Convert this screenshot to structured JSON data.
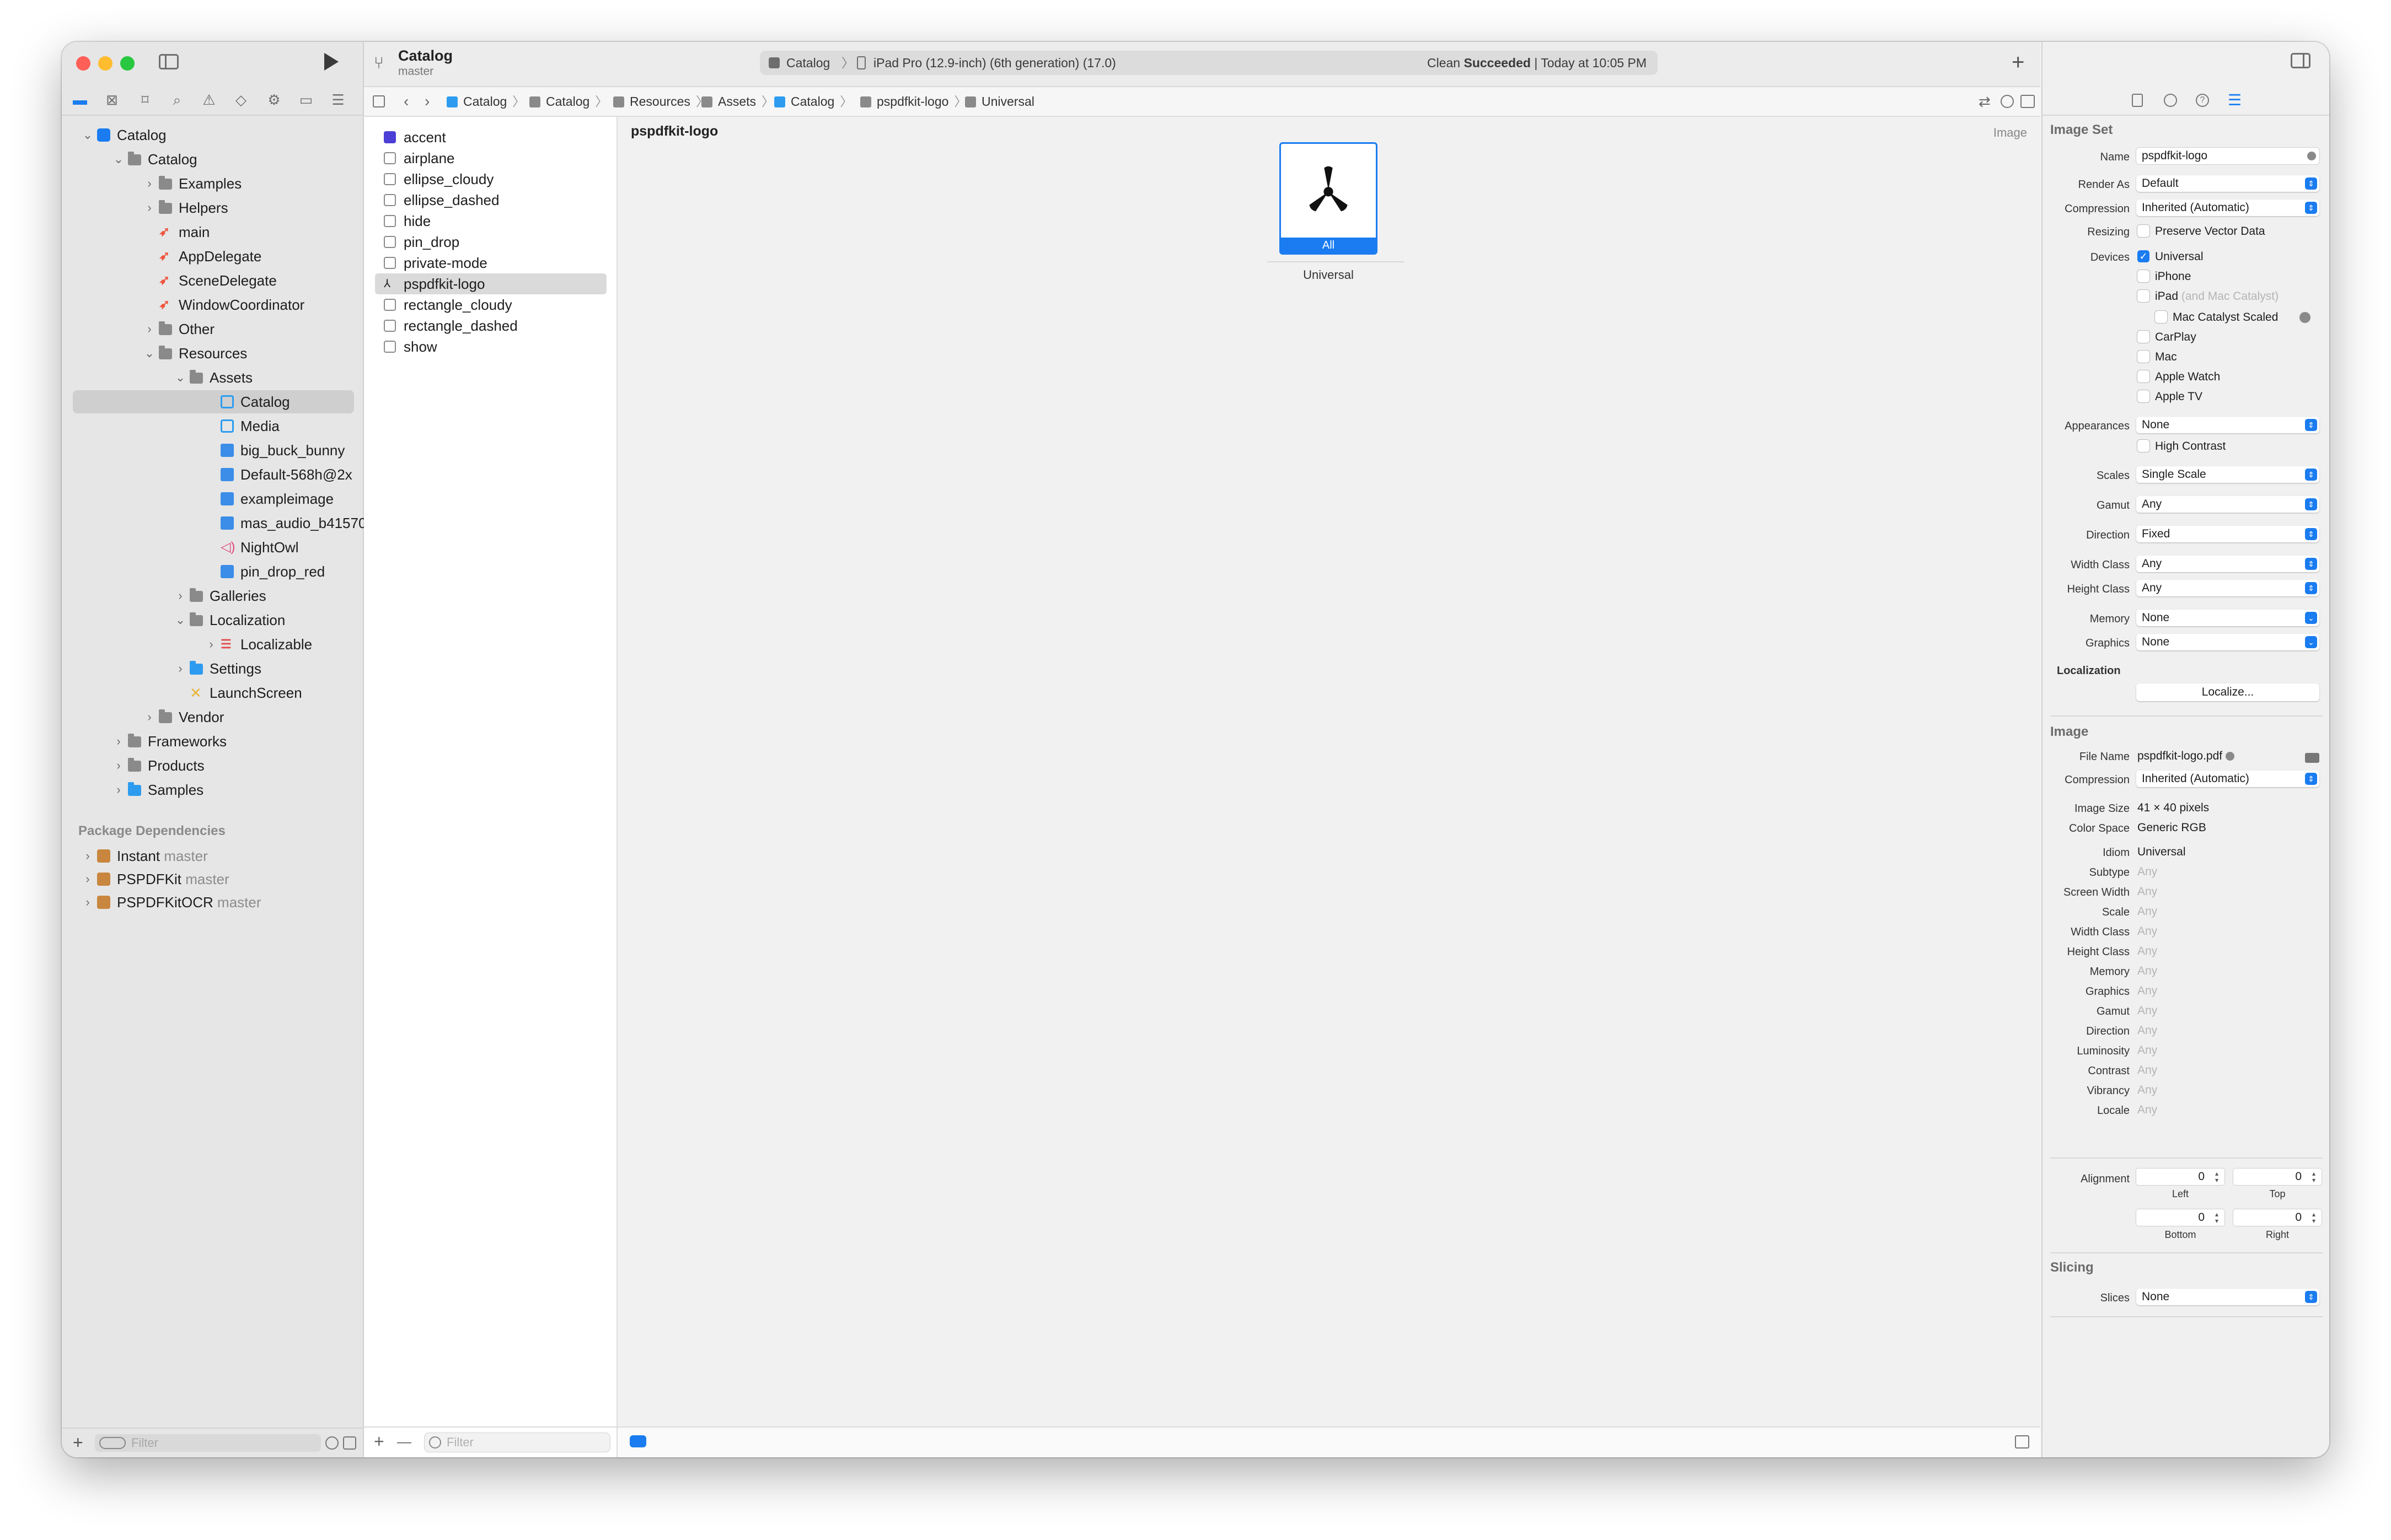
{
  "toolbar": {
    "scheme_title": "Catalog",
    "scheme_branch": "master",
    "activity_scheme": "Catalog",
    "activity_device": "iPad Pro (12.9-inch) (6th generation) (17.0)",
    "status_prefix": "Clean ",
    "status_bold": "Succeeded",
    "status_suffix": " | Today at 10:05 PM",
    "add": "+"
  },
  "navigator": {
    "tree": [
      {
        "label": "Catalog",
        "level": 0,
        "chev": "v",
        "icon": "appicon"
      },
      {
        "label": "Catalog",
        "level": 1,
        "chev": "v",
        "icon": "folder"
      },
      {
        "label": "Examples",
        "level": 2,
        "chev": ">",
        "icon": "folder"
      },
      {
        "label": "Helpers",
        "level": 2,
        "chev": ">",
        "icon": "folder"
      },
      {
        "label": "main",
        "level": 2,
        "chev": "",
        "icon": "swift"
      },
      {
        "label": "AppDelegate",
        "level": 2,
        "chev": "",
        "icon": "swift"
      },
      {
        "label": "SceneDelegate",
        "level": 2,
        "chev": "",
        "icon": "swift"
      },
      {
        "label": "WindowCoordinator",
        "level": 2,
        "chev": "",
        "icon": "swift"
      },
      {
        "label": "Other",
        "level": 2,
        "chev": ">",
        "icon": "folder"
      },
      {
        "label": "Resources",
        "level": 2,
        "chev": "v",
        "icon": "folder"
      },
      {
        "label": "Assets",
        "level": 3,
        "chev": "v",
        "icon": "folder"
      },
      {
        "label": "Catalog",
        "level": 4,
        "chev": "",
        "icon": "asset",
        "selected": true
      },
      {
        "label": "Media",
        "level": 4,
        "chev": "",
        "icon": "asset"
      },
      {
        "label": "big_buck_bunny",
        "level": 4,
        "chev": "",
        "icon": "img"
      },
      {
        "label": "Default-568h@2x",
        "level": 4,
        "chev": "",
        "icon": "img"
      },
      {
        "label": "exampleimage",
        "level": 4,
        "chev": "",
        "icon": "img"
      },
      {
        "label": "mas_audio_b41570",
        "level": 4,
        "chev": "",
        "icon": "img"
      },
      {
        "label": "NightOwl",
        "level": 4,
        "chev": "",
        "icon": "sound"
      },
      {
        "label": "pin_drop_red",
        "level": 4,
        "chev": "",
        "icon": "img"
      },
      {
        "label": "Galleries",
        "level": 3,
        "chev": ">",
        "icon": "folder"
      },
      {
        "label": "Localization",
        "level": 3,
        "chev": "v",
        "icon": "folder"
      },
      {
        "label": "Localizable",
        "level": 4,
        "chev": ">",
        "icon": "strings"
      },
      {
        "label": "Settings",
        "level": 3,
        "chev": ">",
        "icon": "folderblue"
      },
      {
        "label": "LaunchScreen",
        "level": 3,
        "chev": "",
        "icon": "ib"
      },
      {
        "label": "Vendor",
        "level": 2,
        "chev": ">",
        "icon": "folder"
      },
      {
        "label": "Frameworks",
        "level": 1,
        "chev": ">",
        "icon": "folder"
      },
      {
        "label": "Products",
        "level": 1,
        "chev": ">",
        "icon": "folder"
      },
      {
        "label": "Samples",
        "level": 1,
        "chev": ">",
        "icon": "folderblue"
      }
    ],
    "package_header": "Package Dependencies",
    "packages": [
      {
        "name": "Instant",
        "branch": "master"
      },
      {
        "name": "PSPDFKit",
        "branch": "master"
      },
      {
        "name": "PSPDFKitOCR",
        "branch": "master"
      }
    ],
    "filter_placeholder": "Filter",
    "add": "+"
  },
  "pathbar": [
    "Catalog",
    "Catalog",
    "Resources",
    "Assets",
    "Catalog",
    "pspdfkit-logo",
    "Universal"
  ],
  "assets": {
    "items": [
      {
        "label": "accent",
        "kind": "color"
      },
      {
        "label": "airplane",
        "kind": "symbol"
      },
      {
        "label": "ellipse_cloudy",
        "kind": "symbol"
      },
      {
        "label": "ellipse_dashed",
        "kind": "symbol"
      },
      {
        "label": "hide",
        "kind": "symbol"
      },
      {
        "label": "pin_drop",
        "kind": "symbol"
      },
      {
        "label": "private-mode",
        "kind": "symbol"
      },
      {
        "label": "pspdfkit-logo",
        "kind": "image",
        "selected": true
      },
      {
        "label": "rectangle_cloudy",
        "kind": "symbol"
      },
      {
        "label": "rectangle_dashed",
        "kind": "symbol"
      },
      {
        "label": "show",
        "kind": "symbol"
      }
    ],
    "add": "+",
    "remove": "—",
    "filter_placeholder": "Filter"
  },
  "editor": {
    "title": "pspdfkit-logo",
    "type": "Image",
    "slot_label": "All",
    "slot_caption": "Universal"
  },
  "inspector": {
    "image_set_header": "Image Set",
    "name_label": "Name",
    "name_value": "pspdfkit-logo",
    "render_as_label": "Render As",
    "render_as_value": "Default",
    "compression_label": "Compression",
    "compression_value": "Inherited (Automatic)",
    "resizing_label": "Resizing",
    "resizing_value": "Preserve Vector Data",
    "devices_label": "Devices",
    "device_universal": "Universal",
    "device_iphone": "iPhone",
    "device_ipad": "iPad",
    "device_ipad_sub": "(and Mac Catalyst)",
    "device_mac_catalyst_scaled": "Mac Catalyst Scaled",
    "device_carplay": "CarPlay",
    "device_mac": "Mac",
    "device_apple_watch": "Apple Watch",
    "device_apple_tv": "Apple TV",
    "appearances_label": "Appearances",
    "appearances_value": "None",
    "high_contrast": "High Contrast",
    "scales_label": "Scales",
    "scales_value": "Single Scale",
    "gamut_label": "Gamut",
    "gamut_value": "Any",
    "direction_label": "Direction",
    "direction_value": "Fixed",
    "width_class_label": "Width Class",
    "width_class_value": "Any",
    "height_class_label": "Height Class",
    "height_class_value": "Any",
    "memory_label": "Memory",
    "memory_value": "None",
    "graphics_label": "Graphics",
    "graphics_value": "None",
    "localization_header": "Localization",
    "localize_button": "Localize...",
    "image_header": "Image",
    "file_name_label": "File Name",
    "file_name_value": "pspdfkit-logo.pdf",
    "image_compression_label": "Compression",
    "image_compression_value": "Inherited (Automatic)",
    "image_size_label": "Image Size",
    "image_size_value": "41 × 40 pixels",
    "color_space_label": "Color Space",
    "color_space_value": "Generic RGB",
    "idiom_label": "Idiom",
    "idiom_value": "Universal",
    "traits": [
      {
        "label": "Subtype",
        "value": "Any"
      },
      {
        "label": "Screen Width",
        "value": "Any"
      },
      {
        "label": "Scale",
        "value": "Any"
      },
      {
        "label": "Width Class",
        "value": "Any"
      },
      {
        "label": "Height Class",
        "value": "Any"
      },
      {
        "label": "Memory",
        "value": "Any"
      },
      {
        "label": "Graphics",
        "value": "Any"
      },
      {
        "label": "Gamut",
        "value": "Any"
      },
      {
        "label": "Direction",
        "value": "Any"
      },
      {
        "label": "Luminosity",
        "value": "Any"
      },
      {
        "label": "Contrast",
        "value": "Any"
      },
      {
        "label": "Vibrancy",
        "value": "Any"
      },
      {
        "label": "Locale",
        "value": "Any"
      }
    ],
    "alignment_label": "Alignment",
    "align_left_value": "0",
    "align_left_caption": "Left",
    "align_top_value": "0",
    "align_top_caption": "Top",
    "align_bottom_value": "0",
    "align_bottom_caption": "Bottom",
    "align_right_value": "0",
    "align_right_caption": "Right",
    "slicing_header": "Slicing",
    "slices_label": "Slices",
    "slices_value": "None"
  },
  "colors": {
    "accent_blue": "#1a7cf0",
    "folder_gray": "#8a8a8a",
    "swift_orange": "#f05138",
    "accent_swatch": "#4b3fd6",
    "close_red": "#fe5f57",
    "minimize_yellow": "#febc2e",
    "zoom_green": "#28c840"
  }
}
